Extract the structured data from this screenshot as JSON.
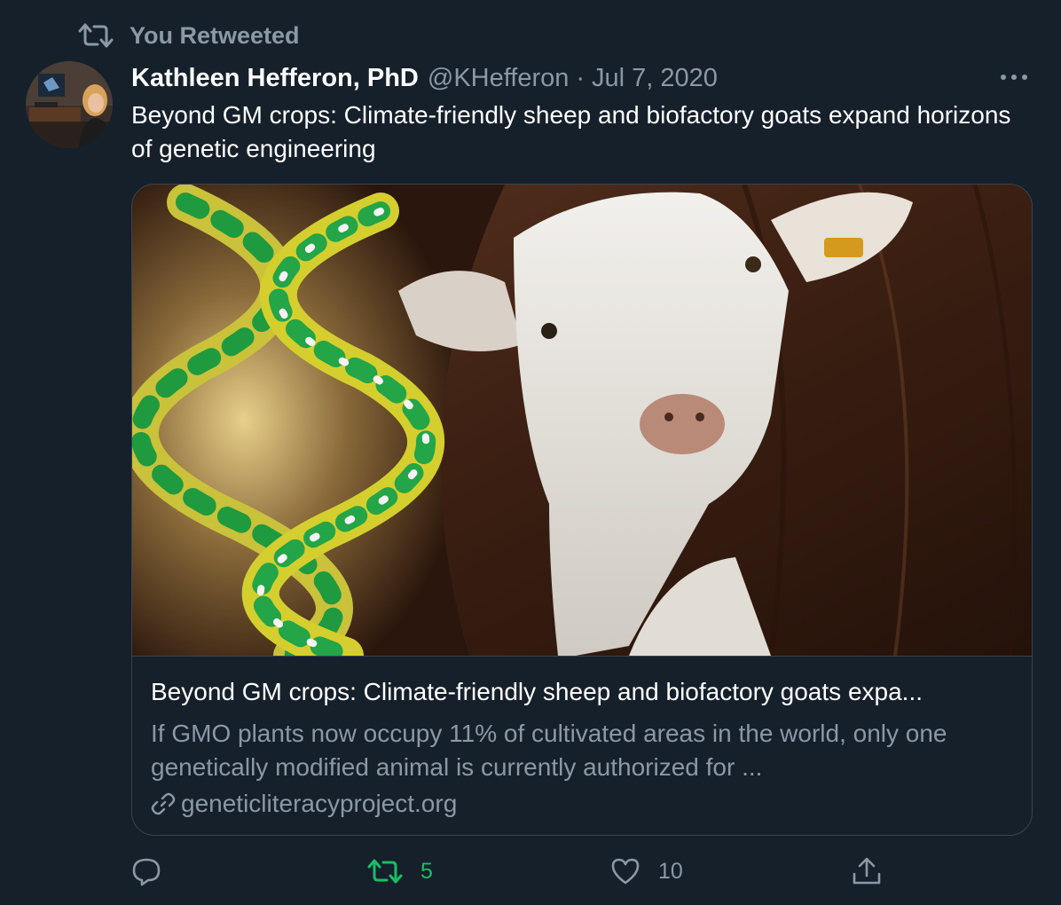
{
  "retweet_banner": {
    "label": "You Retweeted",
    "icon": "retweet-icon"
  },
  "author": {
    "name": "Kathleen Hefferon, PhD",
    "handle": "@KHefferon",
    "separator": "·",
    "date": "Jul 7, 2020"
  },
  "tweet": {
    "text": "Beyond GM crops: Climate-friendly sheep and biofactory goats expand horizons of genetic engineering"
  },
  "card": {
    "title": "Beyond GM crops: Climate-friendly sheep and biofactory goats expa...",
    "description": "If GMO plants now occupy 11% of cultivated areas in the world, only one genetically modified animal is currently authorized for ...",
    "domain": "geneticliteracyproject.org",
    "image_icon": "dna-and-goat-image"
  },
  "actions": {
    "reply": {
      "icon": "reply-icon",
      "count": ""
    },
    "retweet": {
      "icon": "retweet-icon",
      "count": "5",
      "active_color": "#17bf63"
    },
    "like": {
      "icon": "heart-icon",
      "count": "10"
    },
    "share": {
      "icon": "share-icon",
      "count": ""
    }
  },
  "colors": {
    "background": "#15202b",
    "primary_text": "#ffffff",
    "secondary_text": "#8b98a5",
    "border": "#38444d",
    "retweet_green": "#17bf63"
  }
}
